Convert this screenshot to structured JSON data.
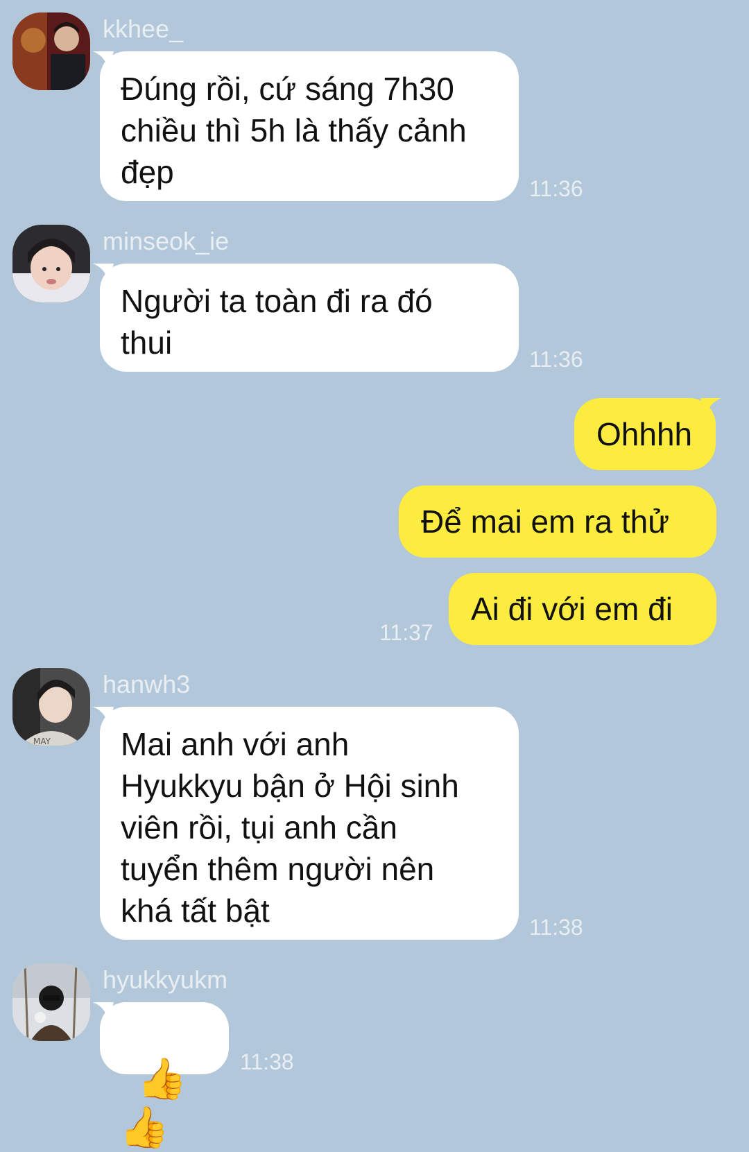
{
  "messages": [
    {
      "sender": "kkhee_",
      "text": "Đúng rồi, cứ sáng 7h30\nchiều thì 5h là thấy cảnh\nđẹp",
      "time": "11:36"
    },
    {
      "sender": "minseok_ie",
      "text": "Người ta toàn đi ra đó\nthui",
      "time": "11:36"
    },
    {
      "sender": "me",
      "text": "Ohhhh"
    },
    {
      "sender": "me",
      "text": "Để mai em ra thử"
    },
    {
      "sender": "me",
      "text": "Ai đi với em đi",
      "time": "11:37"
    },
    {
      "sender": "hanwh3",
      "text": "Mai anh với anh\nHyukkyu bận ở Hội sinh\nviên rồi, tụi anh cần\ntuyển thêm người nên\nkhá tất bật",
      "time": "11:38"
    },
    {
      "sender": "hyukkyukm",
      "text": "👍👍",
      "time": "11:38"
    }
  ],
  "colors": {
    "background": "#b2c7da",
    "incoming_bubble": "#ffffff",
    "outgoing_bubble": "#fbec3f",
    "meta_text": "#e9eef3"
  }
}
